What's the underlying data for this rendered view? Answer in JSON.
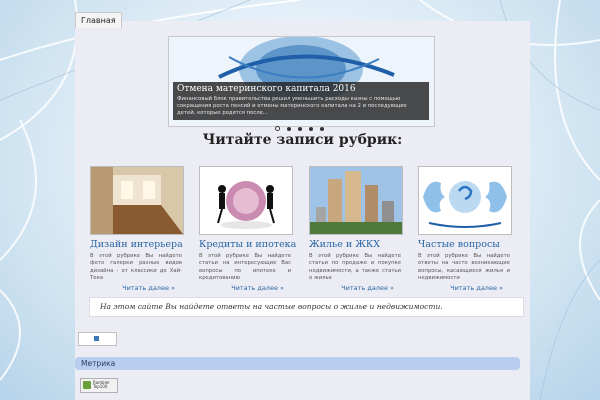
{
  "nav": {
    "home_label": "Главная"
  },
  "slider": {
    "title": "Отмена материнского капитала 2016",
    "text": "Финансовый блок правительства решил уменьшить расходы казны с помощью сокращения роста пенсий и отмены материнского капитала на 2 и последующих детей, которые родятся после..."
  },
  "section_title": "Читайте записи рубрик:",
  "categories": [
    {
      "title": "Дизайн интерьера",
      "description": "В этой рубрике Вы найдете фото галереи разных видов дизайна - от классики до Хай-Тека",
      "more": "Читать далее »"
    },
    {
      "title": "Кредиты и ипотека",
      "description": "В этой рубрике Вы найдете статьи на интересующие Вас вопросы по ипотеке и кредитованию",
      "more": "Читать далее »"
    },
    {
      "title": "Жилье и ЖКХ",
      "description": "В этой рубрике Вы найдете статьи по продаже и покупке недвижимости, а также статьи о жилье",
      "more": "Читать далее »"
    },
    {
      "title": "Частые вопросы",
      "description": "В этой рубрике Вы найдете ответы на часто возникающие вопросы, касающиеся жилья и недвижимости",
      "more": "Читать далее »"
    }
  ],
  "info_text": "На этом сайте Вы найдете ответы на частые вопросы о жилье и недвижимости.",
  "footer": {
    "metrika_label": "Метрика",
    "counter_label": "Rambler Top100"
  },
  "colors": {
    "link": "#2b67a5",
    "metrika_bar": "#b9cdee",
    "content_bg": "#ececf4"
  }
}
